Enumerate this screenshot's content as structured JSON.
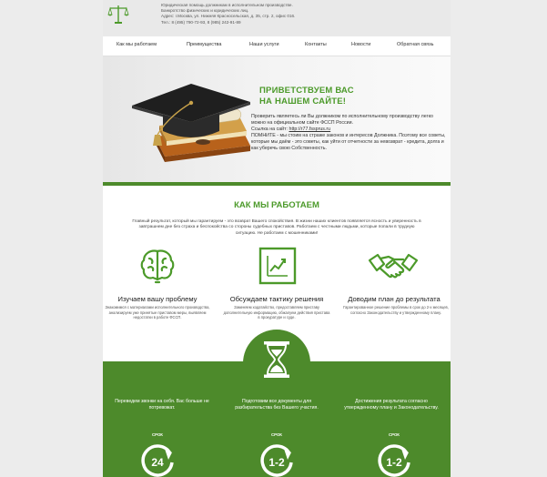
{
  "header": {
    "line1": "Юридическая помощь должникам в исполнительном производстве.",
    "line2": "Банкротство физических и юридических лиц.",
    "line3": "Адрес: г.Москва, ул. Нижняя Красносельская, д. 35, стр. 2, офис 016.",
    "line4": "Тел.: 8 (495) 790-72-93, 8 (985) 242-91-89"
  },
  "nav": {
    "items": [
      "Как мы работаем",
      "Преимущества",
      "Наши услуги",
      "Контакты",
      "Новости",
      "Обратная связь"
    ]
  },
  "hero": {
    "title_line1": "ПРИВЕТСТВУЕМ ВАС",
    "title_line2": "НА НАШЕМ САЙТЕ!",
    "text1": "Проверить являетесь ли Вы должником по исполнительному производству легко можно на официальном сайте ФССП России.",
    "link_prefix": "Ссылка на сайт: ",
    "link_text": "http://r77.fssprus.ru",
    "text2": "ПОМНИТЕ - мы стоим на страже законов и интересов Должника. Поэтому все советы, которые мы даём - это советы, как уйти от отчетности за невозврат - кредита, долга и как уберечь свою Собственность."
  },
  "how": {
    "title": "КАК МЫ РАБОТАЕМ",
    "intro": "Главный результат, который мы гарантируем - это возврат Вашего спокойствия. В жизни наших клиентов появляется ясность и уверенность в завтрашнем дне без страха и беспокойства со стороны судебных приставов. Работаем с честными людьми, которые попали в трудную ситуацию. Не работаем с мошенниками!",
    "features": [
      {
        "title": "Изучаем вашу проблему",
        "text": "Знакомимся с материалами исполнительного производства, анализируем уже принятые приставом меры, выявляем недостатки в работе ФССП.",
        "icon": "brain-icon"
      },
      {
        "title": "Обсуждаем тактику решения",
        "text": "Заменяем ходатайство, предоставляем приставу дополнительную информацию, обжалуем действия пристава в прокуратуре и суде.",
        "icon": "chart-icon"
      },
      {
        "title": "Доводим план до результата",
        "text": "Гарантированное решение проблемы в срок до 2-х месяцев, согласно Законодательству и утвержденному плану.",
        "icon": "handshake-icon"
      }
    ]
  },
  "steps": [
    {
      "text": "Переведем звонки на себя. Вас больше не потревожат.",
      "srok_label": "СРОК",
      "value": "24"
    },
    {
      "text": "Подготовим все документы для разбирательства без Вашего участия.",
      "srok_label": "СРОК",
      "value": "1-2"
    },
    {
      "text": "Достижения результата согласно утвержденному плану и Законодательству.",
      "srok_label": "СРОК",
      "value": "1-2"
    }
  ],
  "colors": {
    "accent": "#4c9a2a",
    "green_bg": "#4d8a2b",
    "header_bg": "#e9e9e9"
  }
}
